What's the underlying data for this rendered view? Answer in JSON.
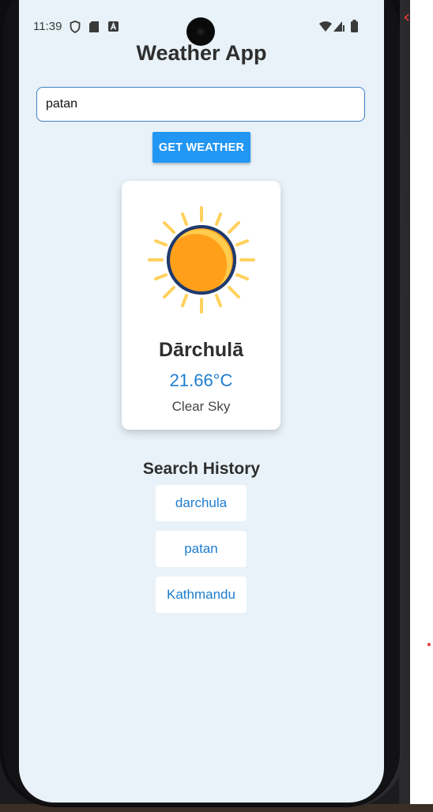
{
  "status_bar": {
    "time": "11:39",
    "left_icons": [
      "shield-icon",
      "sd-card-icon",
      "a-badge-icon"
    ],
    "right_icons": [
      "wifi-icon",
      "signal-icon",
      "battery-icon"
    ]
  },
  "app": {
    "title": "Weather App"
  },
  "search": {
    "value": "patan",
    "button_label": "GET WEATHER"
  },
  "weather_card": {
    "icon": "sun-icon",
    "city": "Dārchulā",
    "temperature": "21.66°C",
    "description": "Clear Sky"
  },
  "history": {
    "title": "Search History",
    "items": [
      "darchula",
      "patan",
      "Kathmandu"
    ]
  },
  "colors": {
    "screen_bg": "#e8f2f8",
    "accent": "#2196f3",
    "link": "#1d7ccf",
    "sun_fill": "#ffc94a",
    "sun_outline": "#1f3a6e"
  }
}
